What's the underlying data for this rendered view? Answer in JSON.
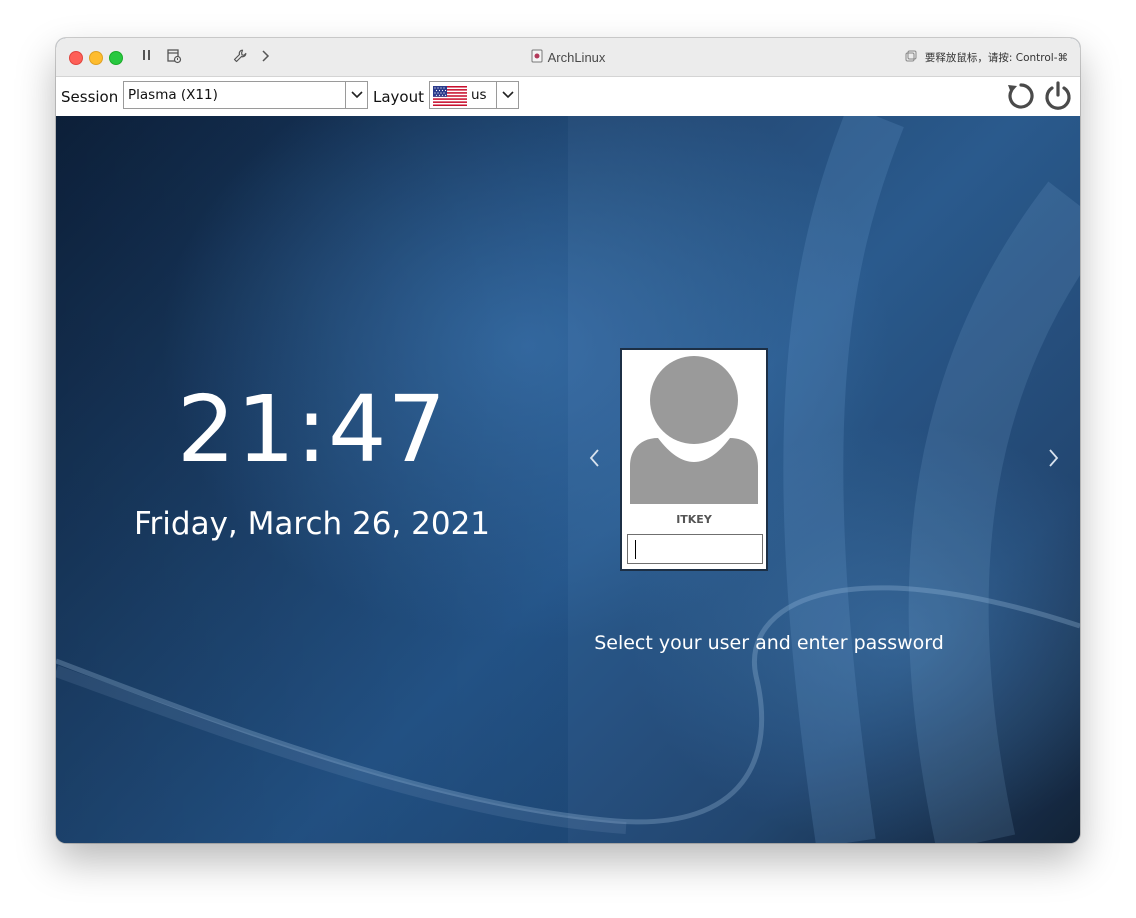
{
  "window": {
    "title": "ArchLinux",
    "release_hint": "要释放鼠标，请按: Control-⌘"
  },
  "toolbar": {
    "session_label": "Session",
    "session_value": "Plasma (X11)",
    "layout_label": "Layout",
    "layout_value": "us",
    "layout_flag": "us-flag-icon"
  },
  "login": {
    "time": "21:47",
    "date": "Friday, March 26, 2021",
    "user_name": "ITKEY",
    "password_value": "",
    "prompt": "Select your user and enter password"
  },
  "icons": {
    "pause": "pause-icon",
    "snapshot": "snapshot-icon",
    "settings": "wrench-icon",
    "more": "chevron-right-icon",
    "restart": "restart-icon",
    "shutdown": "power-icon",
    "prev_user": "chevron-left-icon",
    "next_user": "chevron-right-icon"
  },
  "colors": {
    "background_deep": "#0e2340",
    "background_mid": "#24558a",
    "avatar_gray": "#9a9a9a",
    "card_border": "#1c2f45"
  }
}
